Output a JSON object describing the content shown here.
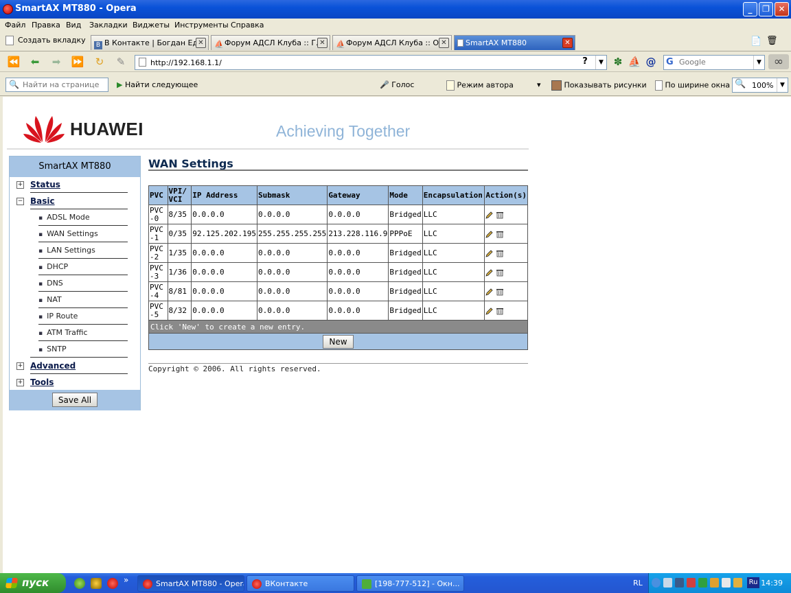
{
  "window": {
    "title": "SmartAX MT880 - Opera"
  },
  "menu": [
    "Файл",
    "Правка",
    "Вид",
    "Закладки",
    "Виджеты",
    "Инструменты",
    "Справка"
  ],
  "tabs": {
    "new_tab": "Создать вкладку",
    "items": [
      {
        "label": "В Контакте | Богдан Ед..."
      },
      {
        "label": "Форум АДСЛ Клуба :: Г..."
      },
      {
        "label": "Форум АДСЛ Клуба :: О..."
      },
      {
        "label": "SmartAX MT880",
        "active": true
      }
    ]
  },
  "nav": {
    "address": "http://192.168.1.1/",
    "help": "?",
    "search_placeholder": "Google"
  },
  "toolbar": {
    "find_placeholder": "Найти на странице",
    "find_next": "Найти следующее",
    "voice": "Голос",
    "author_mode": "Режим автора",
    "show_images": "Показывать рисунки",
    "fit_width": "По ширине окна",
    "zoom": "100%"
  },
  "page": {
    "brand": "HUAWEI",
    "slogan": "Achieving Together",
    "sidebar": {
      "title": "SmartAX MT880",
      "status": "Status",
      "basic": "Basic",
      "sub": [
        "ADSL Mode",
        "WAN Settings",
        "LAN Settings",
        "DHCP",
        "DNS",
        "NAT",
        "IP Route",
        "ATM Traffic",
        "SNTP"
      ],
      "advanced": "Advanced",
      "tools": "Tools",
      "save_all": "Save All"
    },
    "title": "WAN Settings",
    "table": {
      "headers": [
        "PVC",
        "VPI/ VCI",
        "IP Address",
        "Submask",
        "Gateway",
        "Mode",
        "Encapsulation",
        "Action(s)"
      ],
      "rows": [
        [
          "PVC-0",
          "8/35",
          "0.0.0.0",
          "0.0.0.0",
          "0.0.0.0",
          "Bridged",
          "LLC"
        ],
        [
          "PVC-1",
          "0/35",
          "92.125.202.195",
          "255.255.255.255",
          "213.228.116.9",
          "PPPoE",
          "LLC"
        ],
        [
          "PVC-2",
          "1/35",
          "0.0.0.0",
          "0.0.0.0",
          "0.0.0.0",
          "Bridged",
          "LLC"
        ],
        [
          "PVC-3",
          "1/36",
          "0.0.0.0",
          "0.0.0.0",
          "0.0.0.0",
          "Bridged",
          "LLC"
        ],
        [
          "PVC-4",
          "8/81",
          "0.0.0.0",
          "0.0.0.0",
          "0.0.0.0",
          "Bridged",
          "LLC"
        ],
        [
          "PVC-5",
          "8/32",
          "0.0.0.0",
          "0.0.0.0",
          "0.0.0.0",
          "Bridged",
          "LLC"
        ]
      ]
    },
    "hint": "Click 'New' to create a new entry.",
    "new_button": "New",
    "copyright": "Copyright © 2006. All rights reserved."
  },
  "taskbar": {
    "start": "пуск",
    "more": "»",
    "tasks": [
      {
        "label": "SmartAX MT880 - Opera",
        "active": true
      },
      {
        "label": "ВКонтакте"
      },
      {
        "label": "[198-777-512] - Окн..."
      }
    ],
    "lang": "RL",
    "tray_lang": "Ru",
    "clock": "14:39"
  },
  "colors": {
    "accent_blue": "#a6c4e4",
    "title_navy": "#0e2a50",
    "huawei_red": "#d8141e",
    "slogan": "#8fb4d8"
  }
}
